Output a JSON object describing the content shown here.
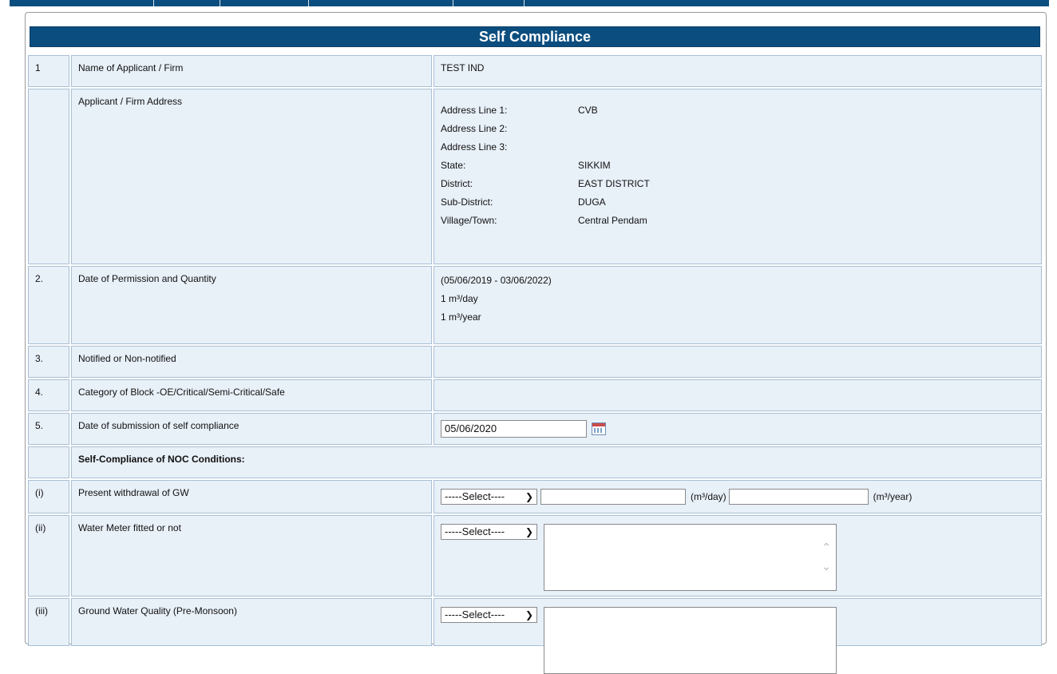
{
  "title": "Self Compliance",
  "rows": [
    {
      "num": "1",
      "label": "Name of Applicant / Firm",
      "value": "TEST IND"
    },
    {
      "num": "",
      "label": "Applicant / Firm Address"
    },
    {
      "num": "2.",
      "label": "Date of Permission and Quantity"
    },
    {
      "num": "3.",
      "label": "Notified or Non-notified",
      "value": ""
    },
    {
      "num": "4.",
      "label": "Category of Block -OE/Critical/Semi-Critical/Safe",
      "value": ""
    },
    {
      "num": "5.",
      "label": "Date of submission of self compliance",
      "value": "05/06/2020"
    },
    {
      "num": "",
      "label": "Self-Compliance of NOC Conditions:"
    },
    {
      "num": "(i)",
      "label": "Present withdrawal of GW",
      "select": "-----Select----",
      "unit1": "(m³/day)",
      "unit2": "(m³/year)"
    },
    {
      "num": "(ii)",
      "label": "Water Meter fitted or not",
      "select": "-----Select----"
    },
    {
      "num": "(iii)",
      "label": "Ground Water Quality (Pre-Monsoon)",
      "select": "-----Select----"
    }
  ],
  "address": {
    "line1_label": "Address Line 1:",
    "line1": "CVB",
    "line2_label": "Address Line 2:",
    "line2": "",
    "line3_label": "Address Line 3:",
    "line3": "",
    "state_label": "State:",
    "state": "SIKKIM",
    "district_label": "District:",
    "district": "EAST DISTRICT",
    "subdistrict_label": "Sub-District:",
    "subdistrict": "DUGA",
    "village_label": "Village/Town:",
    "village": "Central Pendam"
  },
  "permission": {
    "range": "(05/06/2019 - 03/06/2022)",
    "qty_day": "1 m³/day",
    "qty_year": "1 m³/year"
  },
  "icons": {
    "calendar": "calendar-icon",
    "dropdown": "chevron-down-icon"
  },
  "colors": {
    "header": "#0b4d7e",
    "cell_bg": "#e8f0f8",
    "cell_border": "#a9bfd4"
  }
}
